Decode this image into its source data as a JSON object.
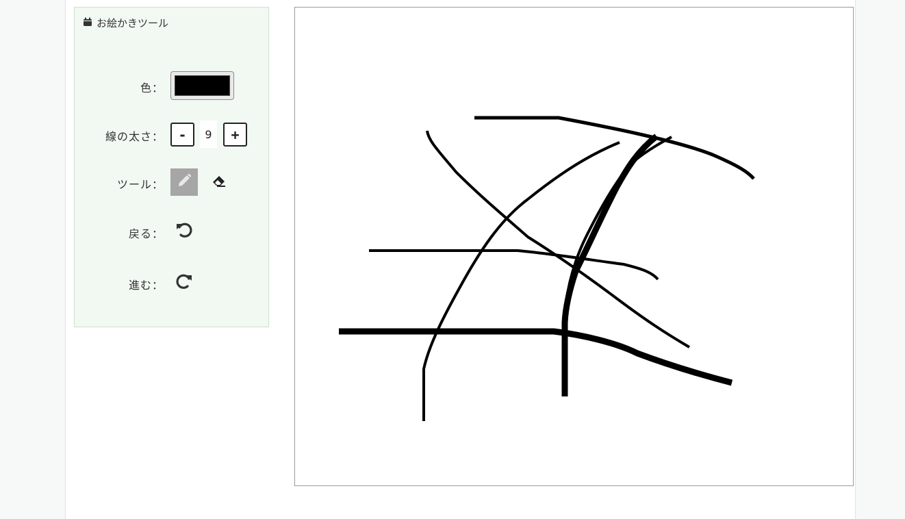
{
  "panel": {
    "title": "お絵かきツール",
    "title_icon": "calendar-icon"
  },
  "color": {
    "label": "色：",
    "value": "#000000"
  },
  "line_width": {
    "label": "線の太さ：",
    "decrement_label": "-",
    "value": "9",
    "increment_label": "+"
  },
  "tool": {
    "label": "ツール：",
    "options": [
      {
        "name": "pencil-icon",
        "active": true
      },
      {
        "name": "eraser-icon",
        "active": false
      }
    ]
  },
  "undo": {
    "label": "戻る：",
    "icon": "undo-icon"
  },
  "redo": {
    "label": "進む：",
    "icon": "redo-icon"
  },
  "canvas": {
    "stroke_color": "#000000",
    "background": "#ffffff"
  }
}
